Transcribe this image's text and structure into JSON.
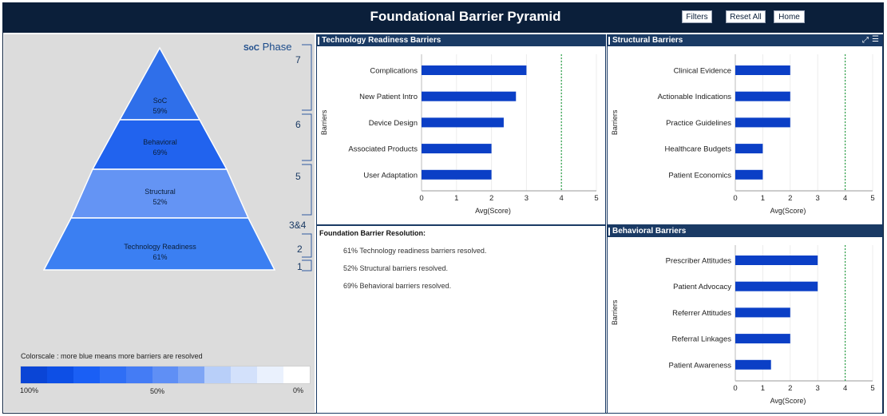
{
  "header": {
    "title": "Foundational Barrier Pyramid",
    "buttons": {
      "filters": "Filters",
      "reset_all": "Reset All",
      "home": "Home"
    }
  },
  "pyramid": {
    "phase_label_prefix": "SoC",
    "phase_label": "Phase",
    "phase_numbers": [
      "7",
      "6",
      "5",
      "3&4",
      "2",
      "1"
    ],
    "levels": [
      {
        "name": "SoC",
        "value": "59%",
        "color": "#2f6fea"
      },
      {
        "name": "Behavioral",
        "value": "69%",
        "color": "#2163ee"
      },
      {
        "name": "Structural",
        "value": "52%",
        "color": "#6494f4"
      },
      {
        "name": "Technology Readiness",
        "value": "61%",
        "color": "#3b7ff2"
      }
    ]
  },
  "colorscale": {
    "caption": "Colorscale : more blue means more barriers are resolved",
    "label_100": "100%",
    "label_50": "50%",
    "label_0": "0%",
    "colors": [
      "#0a45d6",
      "#0d4fe6",
      "#1a5ff5",
      "#2f6ef5",
      "#447cf5",
      "#5f8ff5",
      "#7ea5f5",
      "#b8cff9",
      "#d3e1fb",
      "#eaf1fd",
      "#ffffff"
    ]
  },
  "resolution": {
    "title": "Foundation Barrier Resolution:",
    "lines": [
      "61% Technology readiness barriers resolved.",
      "52% Structural barriers resolved.",
      "69% Behavioral barriers resolved."
    ]
  },
  "chart_data": [
    {
      "id": "tech",
      "type": "bar",
      "orientation": "horizontal",
      "title": "Technology Readiness Barriers",
      "categories": [
        "Complications",
        "New Patient Intro",
        "Device Design",
        "Associated Products",
        "User Adaptation"
      ],
      "values": [
        3.0,
        2.7,
        2.35,
        2.0,
        2.0
      ],
      "xlabel": "Avg(Score)",
      "ylabel": "Barriers",
      "xlim": [
        0,
        5
      ],
      "xticks": [
        "0",
        "1",
        "2",
        "3",
        "4",
        "5"
      ],
      "reference_line": 4,
      "bar_color": "#0b3fc6",
      "reference_color": "#2aa046",
      "grid": true
    },
    {
      "id": "struct",
      "type": "bar",
      "orientation": "horizontal",
      "title": "Structural Barriers",
      "categories": [
        "Clinical Evidence",
        "Actionable Indications",
        "Practice Guidelines",
        "Healthcare Budgets",
        "Patient Economics"
      ],
      "values": [
        2.0,
        2.0,
        2.0,
        1.0,
        1.0
      ],
      "xlabel": "Avg(Score)",
      "ylabel": "Barriers",
      "xlim": [
        0,
        5
      ],
      "xticks": [
        "0",
        "1",
        "2",
        "3",
        "4",
        "5"
      ],
      "reference_line": 4,
      "bar_color": "#0b3fc6",
      "reference_color": "#2aa046",
      "grid": true
    },
    {
      "id": "behav",
      "type": "bar",
      "orientation": "horizontal",
      "title": "Behavioral Barriers",
      "categories": [
        "Prescriber Attitudes",
        "Patient Advocacy",
        "Referrer Attitudes",
        "Referral Linkages",
        "Patient Awareness"
      ],
      "values": [
        3.0,
        3.0,
        2.0,
        2.0,
        1.3
      ],
      "xlabel": "Avg(Score)",
      "ylabel": "Barriers",
      "xlim": [
        0,
        5
      ],
      "xticks": [
        "0",
        "1",
        "2",
        "3",
        "4",
        "5"
      ],
      "reference_line": 4,
      "bar_color": "#0b3fc6",
      "reference_color": "#2aa046",
      "grid": true
    }
  ]
}
